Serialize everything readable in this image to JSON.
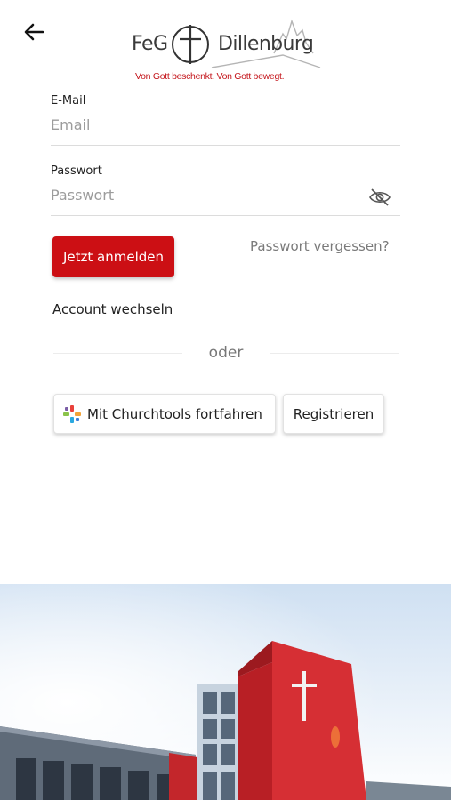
{
  "header": {
    "back_icon": "arrow-left-icon",
    "logo": {
      "left_text": "FeG",
      "right_text": "Dillenburg",
      "tagline": "Von Gott beschenkt. Von Gott bewegt.",
      "brand_color": "#c4161c"
    }
  },
  "form": {
    "email": {
      "label": "E-Mail",
      "placeholder": "Email",
      "value": ""
    },
    "password": {
      "label": "Passwort",
      "placeholder": "Passwort",
      "value": "",
      "toggle_icon": "eye-off-icon"
    },
    "login_button": "Jetzt anmelden",
    "forgot_password": "Passwort vergessen?",
    "switch_account": "Account wechseln",
    "divider_text": "oder",
    "churchtools_button": "Mit Churchtools fortfahren",
    "register_button": "Registrieren"
  },
  "colors": {
    "accent": "#cc0f14",
    "muted_text": "#7a7a7a"
  },
  "photo": {
    "description_icon": "church-building-photo"
  }
}
